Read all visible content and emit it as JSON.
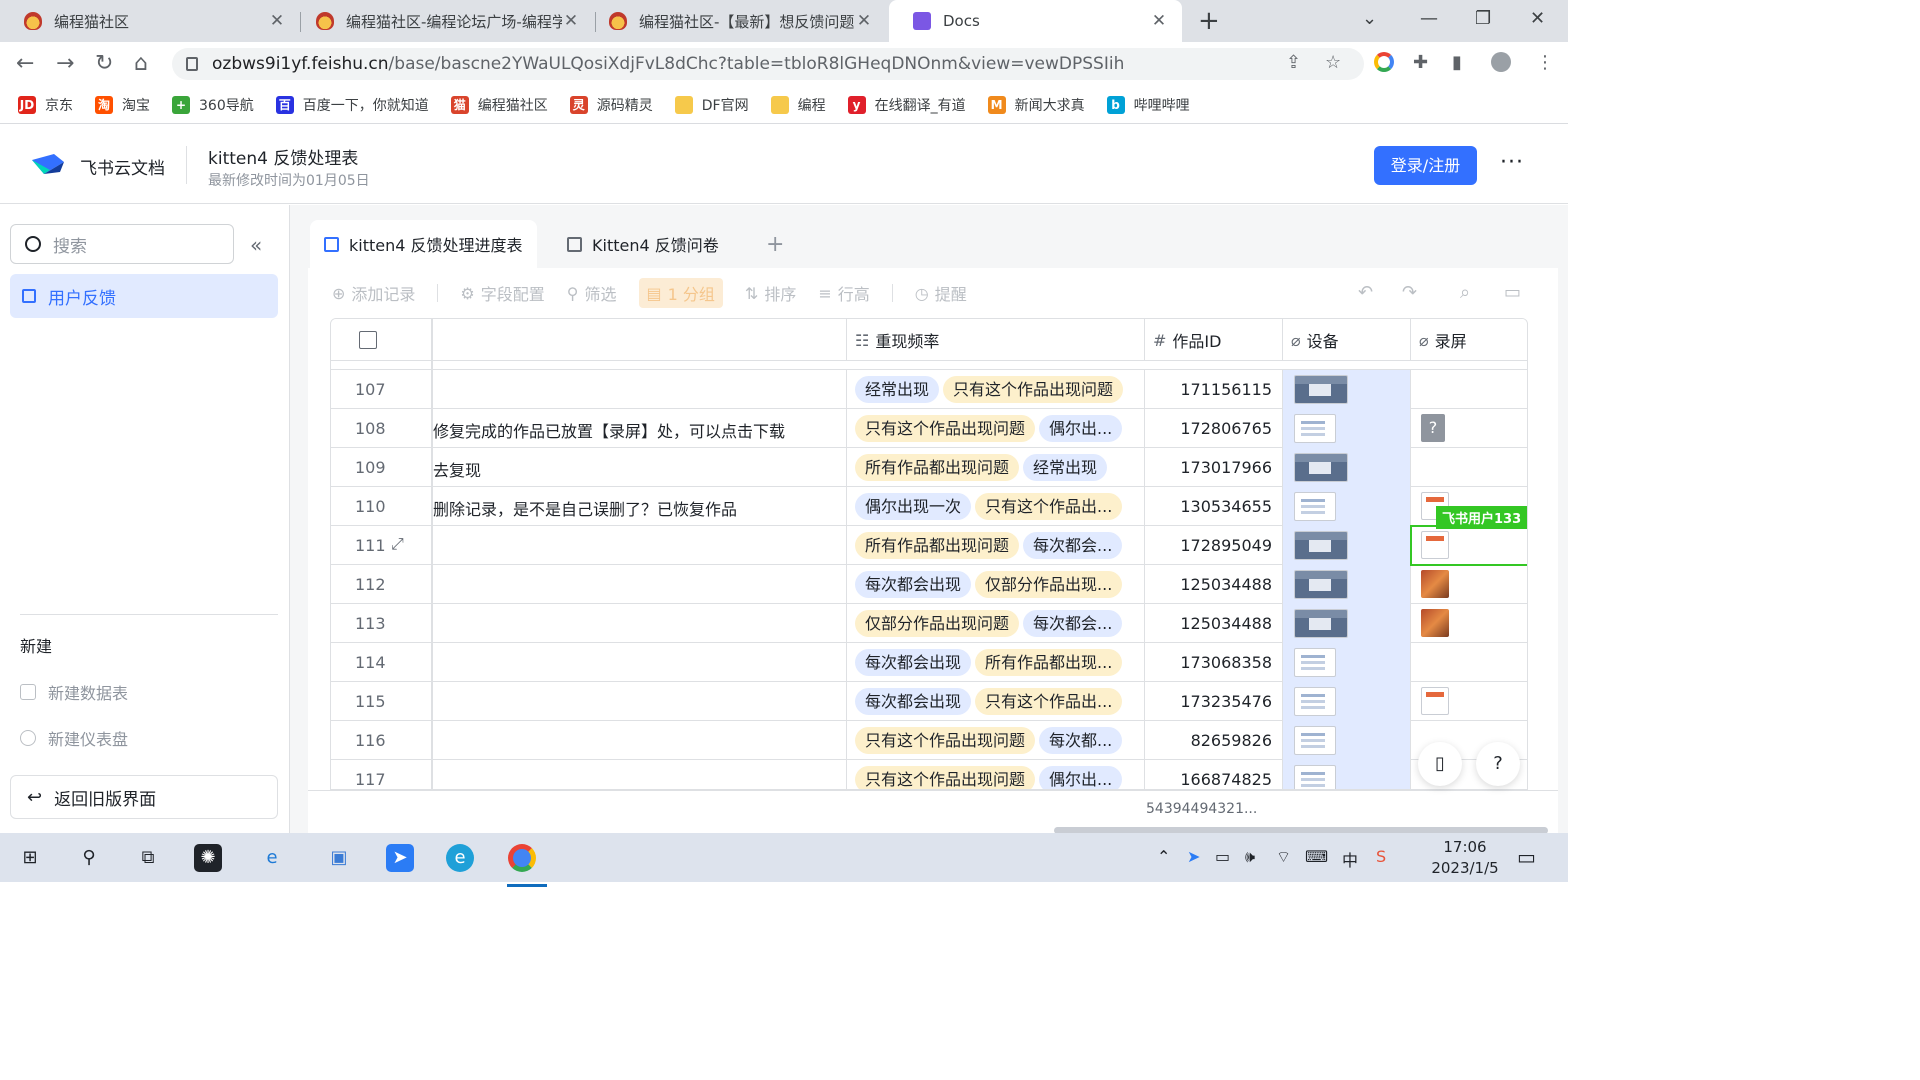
{
  "browser": {
    "tabs": [
      {
        "title": "编程猫社区",
        "icon": "codemao-icon"
      },
      {
        "title": "编程猫社区-编程论坛广场-编程学",
        "icon": "codemao-icon"
      },
      {
        "title": "编程猫社区-【最新】想反馈问题",
        "icon": "codemao-icon"
      },
      {
        "title": "Docs",
        "icon": "docs-icon"
      }
    ],
    "new_tab": "+",
    "url_host": "ozbws9i1yf.feishu.cn",
    "url_path": "/base/bascne2YWaULQosiXdjFvL8dChc?table=tbloR8lGHeqDNOnm&view=vewDPSSIih",
    "bookmarks": [
      {
        "label": "京东",
        "icon": "JD",
        "color": "#e1251b"
      },
      {
        "label": "淘宝",
        "icon": "淘",
        "color": "#ff5000"
      },
      {
        "label": "360导航",
        "icon": "+",
        "color": "#3aa53a"
      },
      {
        "label": "百度一下，你就知道",
        "icon": "百",
        "color": "#2932e1"
      },
      {
        "label": "编程猫社区",
        "icon": "猫",
        "color": "#d9442c"
      },
      {
        "label": "源码精灵",
        "icon": "灵",
        "color": "#d9442c"
      },
      {
        "label": "DF官网",
        "icon": "",
        "color": "#f6c94b"
      },
      {
        "label": "编程",
        "icon": "",
        "color": "#f6c94b"
      },
      {
        "label": "在线翻译_有道",
        "icon": "y",
        "color": "#e0202b"
      },
      {
        "label": "新闻大求真",
        "icon": "M",
        "color": "#f08a1c"
      },
      {
        "label": "哔哩哔哩",
        "icon": "b",
        "color": "#00a1d6"
      }
    ]
  },
  "app": {
    "brand": "飞书云文档",
    "doc_title": "kitten4 反馈处理表",
    "doc_subtitle": "最新修改时间为01月05日",
    "login_label": "登录/注册",
    "more": "···"
  },
  "sidebar": {
    "search_placeholder": "搜索",
    "items": [
      {
        "label": "用户反馈"
      }
    ],
    "new_heading": "新建",
    "new_items": [
      {
        "label": "新建数据表"
      },
      {
        "label": "新建仪表盘"
      }
    ],
    "old_ui_label": "返回旧版界面"
  },
  "main": {
    "tabs": [
      {
        "label": "kitten4 反馈处理进度表"
      },
      {
        "label": "Kitten4 反馈问卷"
      }
    ],
    "toolbar": {
      "add": "添加记录",
      "fields": "字段配置",
      "filter": "筛选",
      "group": "1 分组",
      "sort": "排序",
      "row_height": "行高",
      "remind": "提醒"
    },
    "columns": {
      "freq": "重现频率",
      "id": "作品ID",
      "device": "设备",
      "record": "录屏"
    },
    "rows": [
      {
        "num": "107",
        "text": "",
        "tags": [
          "经常出现",
          "只有这个作品出现问题"
        ],
        "id": "171156115",
        "device": "dark",
        "record": ""
      },
      {
        "num": "108",
        "text": "修复完成的作品已放置【录屏】处，可以点击下载",
        "tags": [
          "只有这个作品出现问题",
          "偶尔出..."
        ],
        "id": "172806765",
        "device": "light",
        "record": "q"
      },
      {
        "num": "109",
        "text": "去复现",
        "tags": [
          "所有作品都出现问题",
          "经常出现"
        ],
        "id": "173017966",
        "device": "dark",
        "record": ""
      },
      {
        "num": "110",
        "text": "删除记录，是不是自己误删了？已恢复作品",
        "tags": [
          "偶尔出现一次",
          "只有这个作品出..."
        ],
        "id": "130534655",
        "device": "light",
        "record": "doc"
      },
      {
        "num": "111",
        "text": "",
        "tags": [
          "所有作品都出现问题",
          "每次都会..."
        ],
        "id": "172895049",
        "device": "dark",
        "record": "doc"
      },
      {
        "num": "112",
        "text": "",
        "tags": [
          "每次都会出现",
          "仅部分作品出现..."
        ],
        "id": "125034488",
        "device": "dark",
        "record": "img"
      },
      {
        "num": "113",
        "text": "",
        "tags": [
          "仅部分作品出现问题",
          "每次都会..."
        ],
        "id": "125034488",
        "device": "dark",
        "record": "img"
      },
      {
        "num": "114",
        "text": "",
        "tags": [
          "每次都会出现",
          "所有作品都出现..."
        ],
        "id": "173068358",
        "device": "light",
        "record": ""
      },
      {
        "num": "115",
        "text": "",
        "tags": [
          "每次都会出现",
          "只有这个作品出..."
        ],
        "id": "173235476",
        "device": "light",
        "record": "doc"
      },
      {
        "num": "116",
        "text": "",
        "tags": [
          "只有这个作品出现问题",
          "每次都..."
        ],
        "id": "82659826",
        "device": "light",
        "record": ""
      },
      {
        "num": "117",
        "text": "",
        "tags": [
          "只有这个作品出现问题",
          "偶尔出..."
        ],
        "id": "166874825",
        "device": "light",
        "record": ""
      }
    ],
    "collaborator": "飞书用户133",
    "summary": "54394494321..."
  },
  "tag_colors": {
    "经常出现": "#e1eaff",
    "只有这个作品出现问题": "#fdf0cc",
    "偶尔出现一次": "#e1eaff",
    "所有作品都出现问题": "#fdf0cc",
    "每次都会出现": "#e1eaff",
    "仅部分作品出现问题": "#fdf0cc"
  },
  "taskbar": {
    "time": "17:06",
    "date": "2023/1/5",
    "ime": "中"
  }
}
